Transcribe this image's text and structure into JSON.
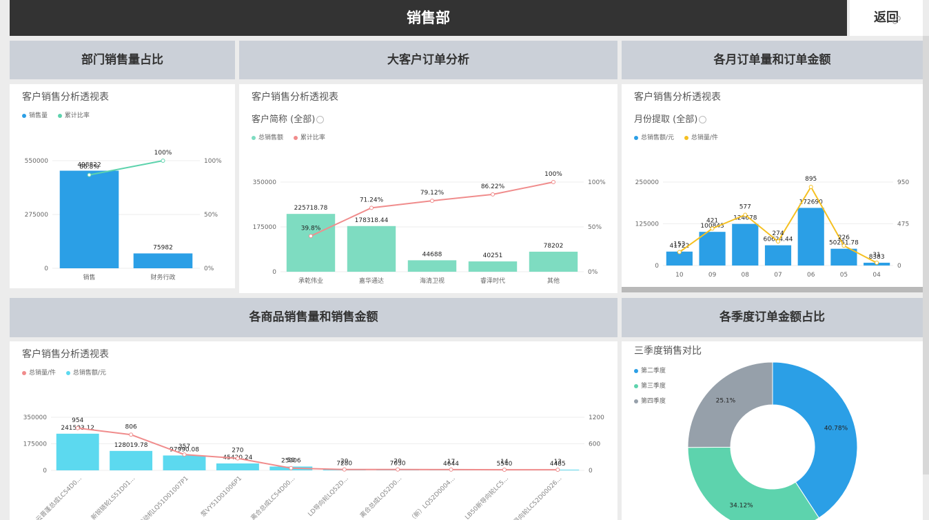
{
  "header": {
    "title": "销售部",
    "back_label": "返回"
  },
  "panels": {
    "p1": {
      "title": "部门销售量占比",
      "subtitle": "客户销售分析透视表"
    },
    "p2": {
      "title": "大客户订单分析",
      "subtitle": "客户销售分析透视表",
      "filter": "客户简称 (全部)"
    },
    "p3": {
      "title": "各月订单量和订单金额",
      "subtitle": "客户销售分析透视表",
      "filter": "月份提取 (全部)"
    },
    "p4": {
      "title": "各商品销售量和销售金额",
      "subtitle": "客户销售分析透视表"
    },
    "p5": {
      "title": "各季度订单金额占比",
      "subtitle": "三季度销售对比"
    }
  },
  "colors": {
    "blue": "#2b9fe6",
    "teal": "#5dd3ad",
    "green_bar": "#7edcc1",
    "salmon": "#f08c8c",
    "yellow": "#f5c021",
    "cyan": "#5cd9ef",
    "grey": "#96a0aa"
  },
  "chart_data": [
    {
      "id": "dept",
      "type": "bar",
      "categories": [
        "销售",
        "财务行政"
      ],
      "series": [
        {
          "name": "销售量",
          "values": [
            498822,
            75982
          ],
          "labels": [
            "498822",
            "75982"
          ]
        },
        {
          "name": "累计比率",
          "values": [
            86.8,
            100
          ],
          "labels": [
            "86.8%",
            "100%"
          ],
          "axis": "right"
        }
      ],
      "y_ticks": [
        "0",
        "275000",
        "550000"
      ],
      "y2_ticks": [
        "0%",
        "50%",
        "100%"
      ],
      "ylim": [
        0,
        550000
      ],
      "y2lim": [
        0,
        100
      ],
      "legend": "top-left"
    },
    {
      "id": "customer",
      "type": "bar",
      "categories": [
        "承乾伟业",
        "嘉华通达",
        "海清卫视",
        "睿泽时代",
        "其他"
      ],
      "series": [
        {
          "name": "总销售额",
          "values": [
            225718.78,
            178318.44,
            44688,
            40251,
            78202
          ],
          "labels": [
            "225718.78",
            "178318.44",
            "44688",
            "40251",
            "78202"
          ]
        },
        {
          "name": "累计比率",
          "values": [
            39.8,
            71.24,
            79.12,
            86.22,
            100
          ],
          "labels": [
            "39.8%",
            "71.24%",
            "79.12%",
            "86.22%",
            "100%"
          ],
          "axis": "right"
        }
      ],
      "y_ticks": [
        "0",
        "175000",
        "350000"
      ],
      "y2_ticks": [
        "0%",
        "50%",
        "100%"
      ],
      "ylim": [
        0,
        350000
      ],
      "y2lim": [
        0,
        100
      ],
      "legend": "top-left"
    },
    {
      "id": "monthly",
      "type": "bar",
      "categories": [
        "10",
        "09",
        "08",
        "07",
        "06",
        "05",
        "04"
      ],
      "series": [
        {
          "name": "总销售额/元",
          "values": [
            41722,
            100843,
            124678,
            60624.44,
            172690,
            50251.78,
            8383
          ],
          "labels": [
            "41722",
            "100843",
            "124678",
            "60624.44",
            "172690",
            "50251.78",
            "8383"
          ]
        },
        {
          "name": "总销量/件",
          "values": [
            153,
            421,
            577,
            274,
            895,
            226,
            31
          ],
          "labels": [
            "153",
            "421",
            "577",
            "274",
            "895",
            "226",
            "31"
          ],
          "axis": "right"
        }
      ],
      "y_ticks": [
        "0",
        "125000",
        "250000"
      ],
      "y2_ticks": [
        "0",
        "475",
        "950"
      ],
      "ylim": [
        0,
        250000
      ],
      "y2lim": [
        0,
        950
      ],
      "legend": "top-left"
    },
    {
      "id": "products",
      "type": "bar",
      "categories": [
        "云晋蓬总成LC54D0...",
        "新锐链轮LS51D01...",
        "发动机LQ51D01007P1",
        "泵VY51D01006P1",
        "离合总成LC54D00...",
        "LD导向轮LQ52D...",
        "离合总成LQ52D0...",
        "离合（新）LQ52D0004...",
        "LB50新导向轮LC5...",
        "导向轮LC52D00026..."
      ],
      "series": [
        {
          "name": "总销量/件",
          "values": [
            954,
            806,
            357,
            270,
            50,
            20,
            20,
            17,
            14,
            13
          ],
          "labels": [
            "954",
            "806",
            "357",
            "270",
            "50",
            "20",
            "20",
            "17",
            "14",
            "13"
          ],
          "axis": "right"
        },
        {
          "name": "总销售额/元",
          "values": [
            241503.12,
            128019.78,
            97990.08,
            45420.24,
            25006,
            7280,
            7030,
            4644,
            5540,
            4485
          ],
          "labels": [
            "241503.12",
            "128019.78",
            "97990.08",
            "45420.24",
            "25006",
            "7280",
            "7030",
            "4644",
            "5540",
            "4485"
          ]
        }
      ],
      "y_ticks": [
        "0",
        "175000",
        "350000"
      ],
      "y2_ticks": [
        "0",
        "600",
        "1200"
      ],
      "ylim": [
        0,
        350000
      ],
      "y2lim": [
        0,
        1200
      ],
      "legend": "top-left"
    },
    {
      "id": "quarters",
      "type": "pie",
      "categories": [
        "第二季度",
        "第三季度",
        "第四季度"
      ],
      "values": [
        40.78,
        34.12,
        25.1
      ],
      "labels": [
        "40.78%",
        "34.12%",
        "25.1%"
      ],
      "legend": "top-left"
    }
  ]
}
